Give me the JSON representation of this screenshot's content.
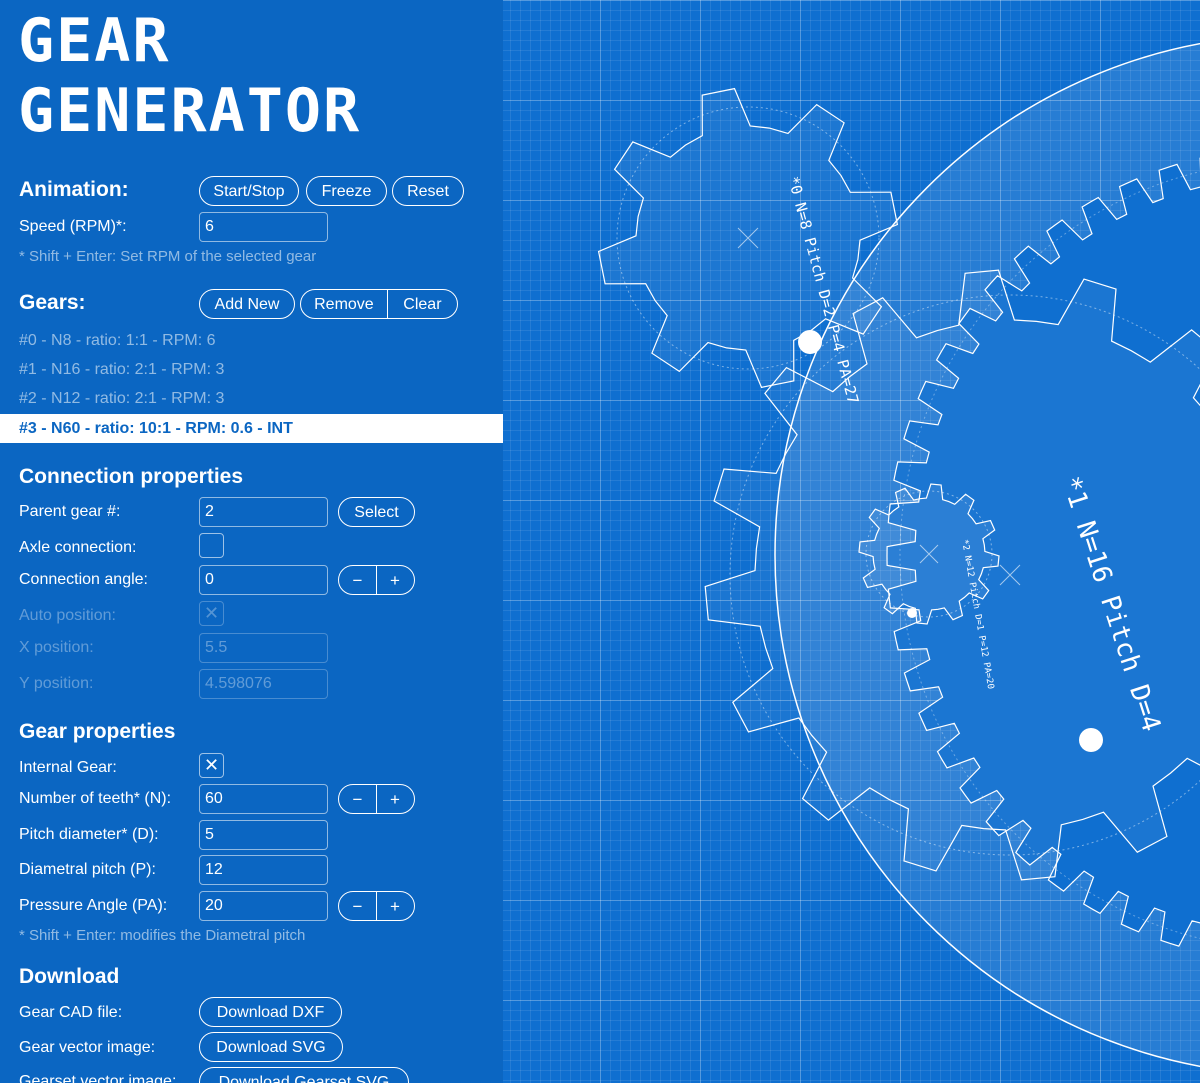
{
  "logo": {
    "line1": "GEAR",
    "line2": "GENERATOR"
  },
  "animation": {
    "title": "Animation:",
    "start_stop": "Start/Stop",
    "freeze": "Freeze",
    "reset": "Reset",
    "speed_label": "Speed (RPM)*:",
    "speed_value": "6",
    "hint": "* Shift + Enter: Set RPM of the selected gear"
  },
  "gears": {
    "title": "Gears:",
    "add_new": "Add New",
    "remove": "Remove",
    "clear": "Clear",
    "items": [
      "#0 - N8 - ratio: 1:1 - RPM: 6",
      "#1 - N16 - ratio: 2:1 - RPM: 3",
      "#2 - N12 - ratio: 2:1 - RPM: 3",
      "#3 - N60 - ratio: 10:1 - RPM: 0.6 - INT"
    ],
    "selected_index": 3
  },
  "connection": {
    "title": "Connection properties",
    "parent_label": "Parent gear #:",
    "parent_value": "2",
    "select": "Select",
    "axle_label": "Axle connection:",
    "angle_label": "Connection angle:",
    "angle_value": "0",
    "minus": "−",
    "plus": "+",
    "auto_label": "Auto position:",
    "auto_mark": "✕",
    "x_label": "X position:",
    "x_value": "5.5",
    "y_label": "Y position:",
    "y_value": "4.598076"
  },
  "gear_props": {
    "title": "Gear properties",
    "internal_label": "Internal Gear:",
    "internal_mark": "✕",
    "teeth_label": "Number of teeth* (N):",
    "teeth_value": "60",
    "pitch_d_label": "Pitch diameter* (D):",
    "pitch_d_value": "5",
    "dp_label": "Diametral pitch (P):",
    "dp_value": "12",
    "pa_label": "Pressure Angle (PA):",
    "pa_value": "20",
    "hint": "* Shift + Enter: modifies the Diametral pitch"
  },
  "download": {
    "title": "Download",
    "cad_label": "Gear CAD file:",
    "cad_button": "Download DXF",
    "svg_label": "Gear vector image:",
    "svg_button": "Download SVG",
    "gearset_label": "Gearset vector image:",
    "gearset_button": "Download Gearset SVG"
  },
  "canvas": {
    "gear0": {
      "teeth": 8,
      "label_id": "*0",
      "label_text": "N=8  Pitch D=2  P=4  PA=27"
    },
    "gear1": {
      "teeth": 16,
      "label_id": "*1",
      "label_text": "N=16  Pitch D=4"
    },
    "gear2": {
      "teeth": 12,
      "label_id": "*2",
      "label_text": "N=12  Pitch D=1  P=12  PA=20"
    },
    "gear3": {
      "teeth": 60
    },
    "colors": {
      "background": "#0f6fd0",
      "line": "#ffffff"
    }
  }
}
